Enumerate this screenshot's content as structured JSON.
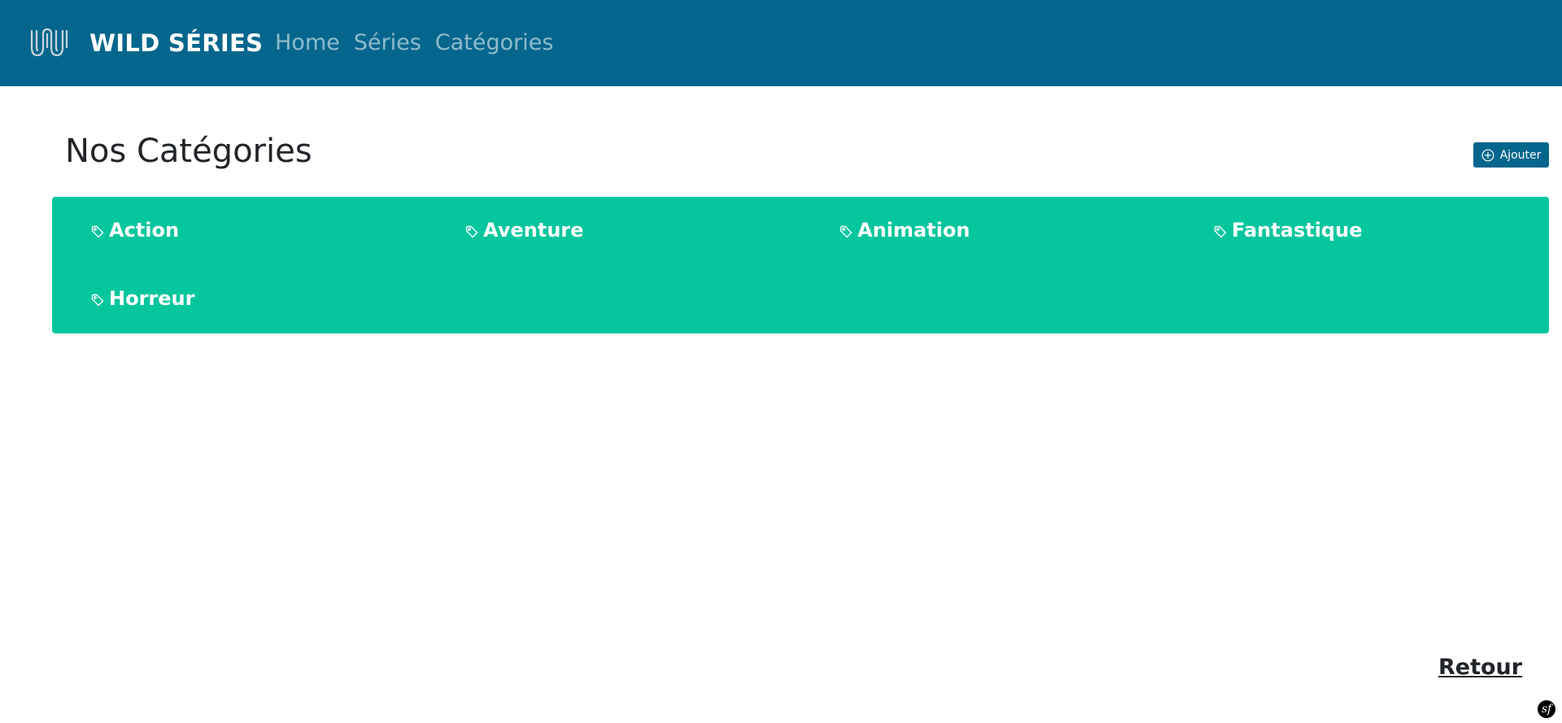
{
  "navbar": {
    "brand": "WILD SÉRIES",
    "logo_icon": "wild-logo-icon",
    "links": [
      {
        "label": "Home"
      },
      {
        "label": "Séries"
      },
      {
        "label": "Catégories"
      }
    ],
    "background_color": "#05668d"
  },
  "main": {
    "title": "Nos Catégories",
    "add_button": {
      "label": "Ajouter",
      "icon": "plus-circle-icon"
    },
    "panel_color": "#05c69d",
    "categories": [
      {
        "label": "Action",
        "icon": "tag-icon"
      },
      {
        "label": "Aventure",
        "icon": "tag-icon"
      },
      {
        "label": "Animation",
        "icon": "tag-icon"
      },
      {
        "label": "Fantastique",
        "icon": "tag-icon"
      },
      {
        "label": "Horreur",
        "icon": "tag-icon"
      }
    ]
  },
  "footer": {
    "back_link": "Retour",
    "toolbar_icon": "symfony-icon",
    "toolbar_glyph": "sf"
  }
}
